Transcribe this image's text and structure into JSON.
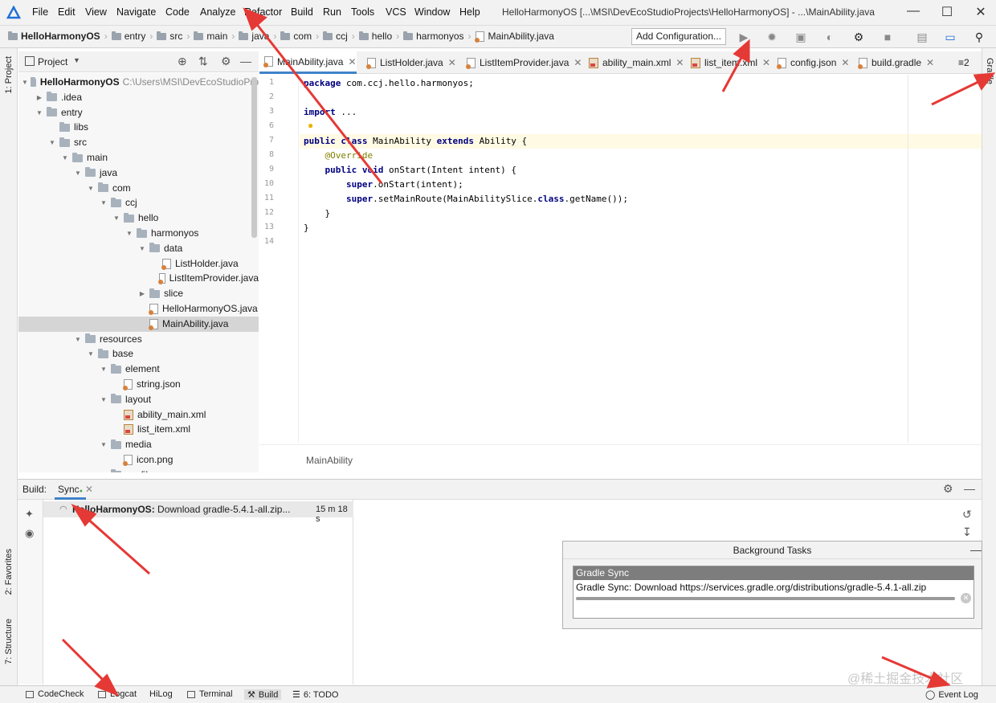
{
  "menu": [
    "File",
    "Edit",
    "View",
    "Navigate",
    "Code",
    "Analyze",
    "Refactor",
    "Build",
    "Run",
    "Tools",
    "VCS",
    "Window",
    "Help"
  ],
  "window_title": "HelloHarmonyOS [...\\MSI\\DevEcoStudioProjects\\HelloHarmonyOS] - ...\\MainAbility.java",
  "breadcrumb": [
    "HelloHarmonyOS",
    "entry",
    "src",
    "main",
    "java",
    "com",
    "ccj",
    "hello",
    "harmonyos",
    "MainAbility.java"
  ],
  "toolbar": {
    "add_config": "Add Configuration..."
  },
  "left_strip": {
    "project": "1: Project",
    "favorites": "2: Favorites",
    "structure": "7: Structure"
  },
  "right_strip": {
    "gradle": "Gradle"
  },
  "project_panel": {
    "title": "Project"
  },
  "tree": [
    {
      "label": "HelloHarmonyOS",
      "extra": "C:\\Users\\MSI\\DevEcoStudioPro",
      "level": 0,
      "arrow": "down",
      "icon": "folder",
      "bold": true
    },
    {
      "label": ".idea",
      "level": 1,
      "arrow": "right",
      "icon": "folder"
    },
    {
      "label": "entry",
      "level": 1,
      "arrow": "down",
      "icon": "folder"
    },
    {
      "label": "libs",
      "level": 2,
      "arrow": "",
      "icon": "folder"
    },
    {
      "label": "src",
      "level": 2,
      "arrow": "down",
      "icon": "folder"
    },
    {
      "label": "main",
      "level": 3,
      "arrow": "down",
      "icon": "folder"
    },
    {
      "label": "java",
      "level": 4,
      "arrow": "down",
      "icon": "folder"
    },
    {
      "label": "com",
      "level": 5,
      "arrow": "down",
      "icon": "folder"
    },
    {
      "label": "ccj",
      "level": 6,
      "arrow": "down",
      "icon": "folder"
    },
    {
      "label": "hello",
      "level": 7,
      "arrow": "down",
      "icon": "folder"
    },
    {
      "label": "harmonyos",
      "level": 8,
      "arrow": "down",
      "icon": "folder"
    },
    {
      "label": "data",
      "level": 9,
      "arrow": "down",
      "icon": "folder"
    },
    {
      "label": "ListHolder.java",
      "level": 10,
      "arrow": "",
      "icon": "java"
    },
    {
      "label": "ListItemProvider.java",
      "level": 10,
      "arrow": "",
      "icon": "java"
    },
    {
      "label": "slice",
      "level": 9,
      "arrow": "right",
      "icon": "folder"
    },
    {
      "label": "HelloHarmonyOS.java",
      "level": 9,
      "arrow": "",
      "icon": "java"
    },
    {
      "label": "MainAbility.java",
      "level": 9,
      "arrow": "",
      "icon": "java",
      "selected": true
    },
    {
      "label": "resources",
      "level": 4,
      "arrow": "down",
      "icon": "folder"
    },
    {
      "label": "base",
      "level": 5,
      "arrow": "down",
      "icon": "folder"
    },
    {
      "label": "element",
      "level": 6,
      "arrow": "down",
      "icon": "folder"
    },
    {
      "label": "string.json",
      "level": 7,
      "arrow": "",
      "icon": "file"
    },
    {
      "label": "layout",
      "level": 6,
      "arrow": "down",
      "icon": "folder"
    },
    {
      "label": "ability_main.xml",
      "level": 7,
      "arrow": "",
      "icon": "xml"
    },
    {
      "label": "list_item.xml",
      "level": 7,
      "arrow": "",
      "icon": "xml"
    },
    {
      "label": "media",
      "level": 6,
      "arrow": "down",
      "icon": "folder"
    },
    {
      "label": "icon.png",
      "level": 7,
      "arrow": "",
      "icon": "file"
    },
    {
      "label": "rawfile",
      "level": 6,
      "arrow": "right",
      "icon": "folder"
    }
  ],
  "tabs": [
    "MainAbility.java",
    "ListHolder.java",
    "ListItemProvider.java",
    "ability_main.xml",
    "list_item.xml",
    "config.json",
    "build.gradle"
  ],
  "tabs_overflow": "≡2",
  "editor": {
    "line_numbers": [
      "1",
      "2",
      "3",
      "6",
      "7",
      "8",
      "9",
      "10",
      "11",
      "12",
      "13",
      "14"
    ],
    "lines": [
      [
        [
          "kw",
          "package"
        ],
        [
          "t",
          " com.ccj.hello.harmonyos;"
        ]
      ],
      [],
      [
        [
          "kw",
          "import"
        ],
        [
          "t",
          " ..."
        ]
      ],
      [],
      [
        [
          "kw",
          "public"
        ],
        [
          "t",
          " "
        ],
        [
          "kw",
          "class"
        ],
        [
          "t",
          " MainAbility "
        ],
        [
          "kw",
          "extends"
        ],
        [
          "t",
          " Ability {"
        ]
      ],
      [
        [
          "t",
          "    "
        ],
        [
          "an",
          "@Override"
        ]
      ],
      [
        [
          "t",
          "    "
        ],
        [
          "kw",
          "public"
        ],
        [
          "t",
          " "
        ],
        [
          "kw",
          "void"
        ],
        [
          "t",
          " onStart(Intent intent) {"
        ]
      ],
      [
        [
          "t",
          "        "
        ],
        [
          "kw",
          "super"
        ],
        [
          "t",
          ".onStart(intent);"
        ]
      ],
      [
        [
          "t",
          "        "
        ],
        [
          "kw",
          "super"
        ],
        [
          "t",
          ".setMainRoute(MainAbilitySlice."
        ],
        [
          "kw",
          "class"
        ],
        [
          "t",
          ".getName());"
        ]
      ],
      [
        [
          "t",
          "    }"
        ]
      ],
      [
        [
          "t",
          "}"
        ]
      ],
      []
    ],
    "breadcrumb": "MainAbility"
  },
  "build": {
    "label": "Build:",
    "tab": "Sync",
    "row_title": "HelloHarmonyOS:",
    "row_text": " Download gradle-5.4.1-all.zip...",
    "row_time": "15 m 18 s"
  },
  "background_tasks": {
    "title": "Background Tasks",
    "task_name": "Gradle Sync",
    "task_desc": "Gradle Sync: Download https://services.gradle.org/distributions/gradle-5.4.1-all.zip"
  },
  "statusbar": {
    "items": [
      "CodeCheck",
      "Logcat",
      "HiLog",
      "Terminal",
      "Build",
      "6: TODO"
    ],
    "event_log": "Event Log"
  },
  "watermark": "@稀土掘金技术社区",
  "colors": {
    "arrow": "#e53935",
    "accent": "#4083c9",
    "keyword": "#000080"
  }
}
